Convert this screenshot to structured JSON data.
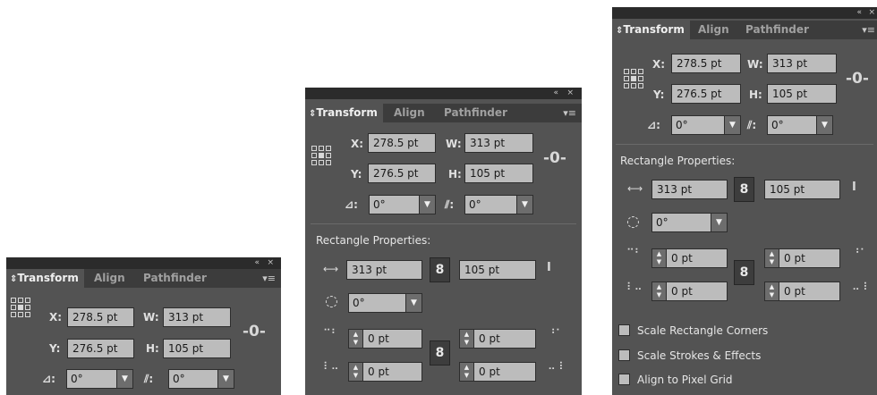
{
  "panels": {
    "tabs": {
      "transform": "Transform",
      "align": "Align",
      "pathfinder": "Pathfinder"
    },
    "window_controls": {
      "collapse": "«",
      "close": "×"
    },
    "menu_glyph": "▾≡",
    "x_label": "X:",
    "x_value": "278.5 pt",
    "y_label": "Y:",
    "y_value": "276.5 pt",
    "w_label": "W:",
    "w_value": "313 pt",
    "h_label": "H:",
    "h_value": "105 pt",
    "angle_label": ":",
    "angle_value": "0°",
    "shear_label": ":",
    "shear_value": "0°",
    "rect_section_title": "Rectangle Properties:",
    "rect_width": "313 pt",
    "rect_height": "105 pt",
    "rect_rotation": "0°",
    "corners": {
      "tl": "0 pt",
      "tr": "0 pt",
      "bl": "0 pt",
      "br": "0 pt"
    },
    "checkboxes": {
      "scale_corners": "Scale Rectangle Corners",
      "scale_strokes": "Scale Strokes & Effects",
      "pixel_grid": "Align to Pixel Grid"
    }
  },
  "colors": {
    "panel_bg": "#535353",
    "tab_bar": "#3c3c3c",
    "field_bg": "#bcbcbc",
    "title_bar": "#2b2b2b"
  }
}
